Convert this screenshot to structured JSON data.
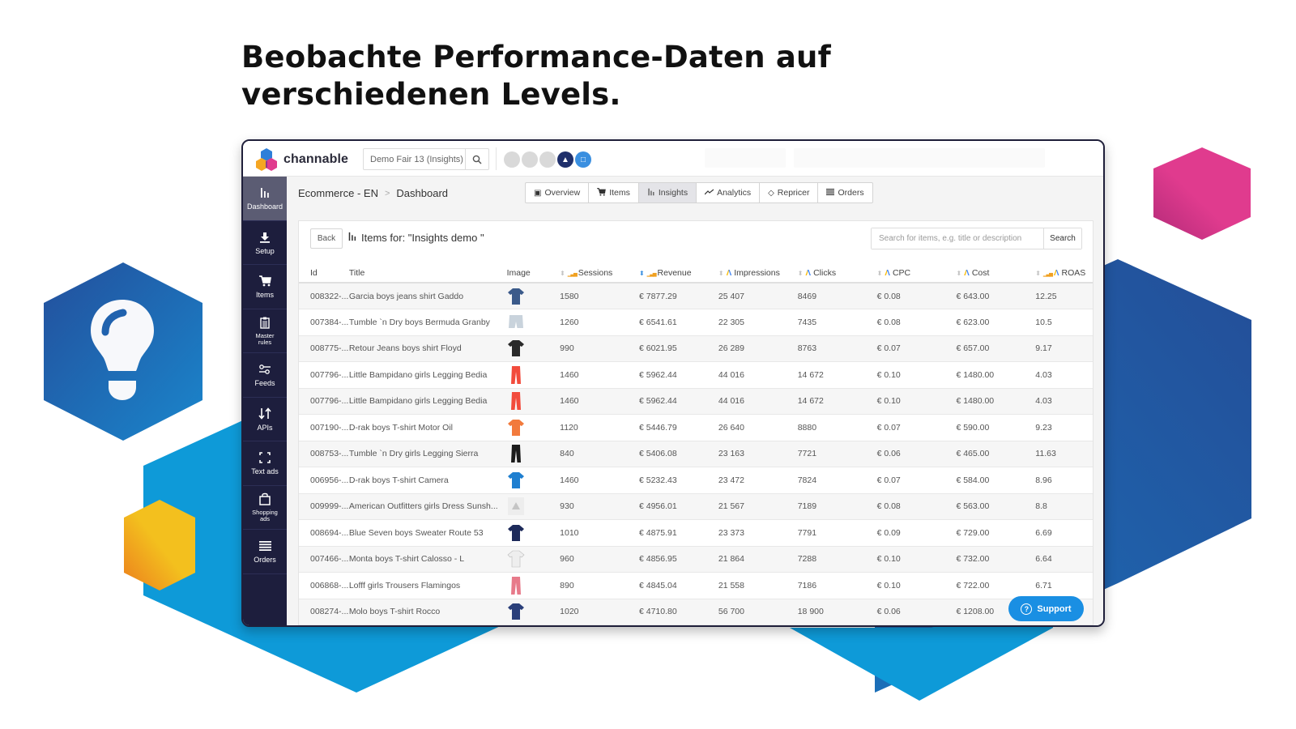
{
  "headline": {
    "line1": "Beobachte Performance-Daten auf",
    "line2": "verschiedenen Levels."
  },
  "app": {
    "brand": "channable",
    "project_select": "Demo Fair 13 (Insights)",
    "search_icon": "search-icon"
  },
  "sidebar": {
    "items": [
      {
        "label": "Dashboard",
        "icon": "bar-chart-icon",
        "glyph": "❙❙",
        "active": true
      },
      {
        "label": "Setup",
        "icon": "download-icon",
        "glyph": "⤓"
      },
      {
        "label": "Items",
        "icon": "cart-icon",
        "glyph": "🛒"
      },
      {
        "label": "Master rules",
        "icon": "clipboard-icon",
        "glyph": "☰"
      },
      {
        "label": "Feeds",
        "icon": "sliders-icon",
        "glyph": "⧟"
      },
      {
        "label": "APIs",
        "icon": "arrows-updown-icon",
        "glyph": "⇅"
      },
      {
        "label": "Text ads",
        "icon": "frame-icon",
        "glyph": "⛶"
      },
      {
        "label": "Shopping ads",
        "icon": "bag-icon",
        "glyph": "▢"
      },
      {
        "label": "Orders",
        "icon": "list-icon",
        "glyph": "≡"
      }
    ]
  },
  "breadcrumb": {
    "parent": "Ecommerce - EN",
    "separator": ">",
    "current": "Dashboard"
  },
  "nav_tabs": [
    {
      "label": "Overview",
      "icon": "monitor-icon",
      "glyph": "▣"
    },
    {
      "label": "Items",
      "icon": "cart-icon",
      "glyph": "⨼"
    },
    {
      "label": "Insights",
      "icon": "bar-chart-icon",
      "glyph": "┃┃",
      "active": true
    },
    {
      "label": "Analytics",
      "icon": "trend-line-icon",
      "glyph": "〜"
    },
    {
      "label": "Repricer",
      "icon": "tag-icon",
      "glyph": "◇"
    },
    {
      "label": "Orders",
      "icon": "list-icon",
      "glyph": "≡"
    }
  ],
  "panel": {
    "back_label": "Back",
    "title": "Items for: \"Insights demo \"",
    "search_placeholder": "Search for items, e.g. title or description",
    "search_value": "",
    "search_button": "Search"
  },
  "table": {
    "columns": [
      {
        "key": "id",
        "label": "Id"
      },
      {
        "key": "title",
        "label": "Title"
      },
      {
        "key": "image",
        "label": "Image"
      },
      {
        "key": "sessions",
        "label": "Sessions",
        "sortable": true,
        "source": "analytics"
      },
      {
        "key": "revenue",
        "label": "Revenue",
        "sortable": true,
        "sort_active": true,
        "source": "analytics"
      },
      {
        "key": "impressions",
        "label": "Impressions",
        "sortable": true,
        "source": "google-ads"
      },
      {
        "key": "clicks",
        "label": "Clicks",
        "sortable": true,
        "source": "google-ads"
      },
      {
        "key": "cpc",
        "label": "CPC",
        "sortable": true,
        "source": "google-ads"
      },
      {
        "key": "cost",
        "label": "Cost",
        "sortable": true,
        "source": "google-ads"
      },
      {
        "key": "roas",
        "label": "ROAS",
        "sortable": true,
        "source": "analytics+google-ads"
      }
    ],
    "rows": [
      {
        "id": "008322-...",
        "title": "Garcia boys jeans shirt Gaddo",
        "image": "denim-shirt",
        "image_color": "#3b5a8a",
        "sessions": "1580",
        "revenue": "€ 7877.29",
        "impressions": "25 407",
        "clicks": "8469",
        "cpc": "€ 0.08",
        "cost": "€ 643.00",
        "roas": "12.25"
      },
      {
        "id": "007384-...",
        "title": "Tumble `n Dry boys Bermuda Granby",
        "image": "shorts",
        "image_color": "#c9d3dc",
        "sessions": "1260",
        "revenue": "€ 6541.61",
        "impressions": "22 305",
        "clicks": "7435",
        "cpc": "€ 0.08",
        "cost": "€ 623.00",
        "roas": "10.5"
      },
      {
        "id": "008775-...",
        "title": "Retour Jeans boys shirt Floyd",
        "image": "jacket",
        "image_color": "#2a2a2a",
        "sessions": "990",
        "revenue": "€ 6021.95",
        "impressions": "26 289",
        "clicks": "8763",
        "cpc": "€ 0.07",
        "cost": "€ 657.00",
        "roas": "9.17"
      },
      {
        "id": "007796-...",
        "title": "Little Bampidano girls Legging Bedia",
        "image": "leggings",
        "image_color": "#f24b3c",
        "sessions": "1460",
        "revenue": "€ 5962.44",
        "impressions": "44 016",
        "clicks": "14 672",
        "cpc": "€ 0.10",
        "cost": "€ 1480.00",
        "roas": "4.03"
      },
      {
        "id": "007796-...",
        "title": "Little Bampidano girls Legging Bedia",
        "image": "leggings",
        "image_color": "#f24b3c",
        "sessions": "1460",
        "revenue": "€ 5962.44",
        "impressions": "44 016",
        "clicks": "14 672",
        "cpc": "€ 0.10",
        "cost": "€ 1480.00",
        "roas": "4.03"
      },
      {
        "id": "007190-...",
        "title": "D-rak boys T-shirt Motor Oil",
        "image": "tshirt",
        "image_color": "#f27a3c",
        "sessions": "1120",
        "revenue": "€ 5446.79",
        "impressions": "26 640",
        "clicks": "8880",
        "cpc": "€ 0.07",
        "cost": "€ 590.00",
        "roas": "9.23"
      },
      {
        "id": "008753-...",
        "title": "Tumble `n Dry girls Legging Sierra",
        "image": "leggings",
        "image_color": "#1c1c1c",
        "sessions": "840",
        "revenue": "€ 5406.08",
        "impressions": "23 163",
        "clicks": "7721",
        "cpc": "€ 0.06",
        "cost": "€ 465.00",
        "roas": "11.63"
      },
      {
        "id": "006956-...",
        "title": "D-rak boys T-shirt Camera",
        "image": "tshirt",
        "image_color": "#1f7fd0",
        "sessions": "1460",
        "revenue": "€ 5232.43",
        "impressions": "23 472",
        "clicks": "7824",
        "cpc": "€ 0.07",
        "cost": "€ 584.00",
        "roas": "8.96"
      },
      {
        "id": "009999-...",
        "title": "American Outfitters girls Dress Sunsh...",
        "image": "missing",
        "image_color": "#e2e2e2",
        "sessions": "930",
        "revenue": "€ 4956.01",
        "impressions": "21 567",
        "clicks": "7189",
        "cpc": "€ 0.08",
        "cost": "€ 563.00",
        "roas": "8.8"
      },
      {
        "id": "008694-...",
        "title": "Blue Seven boys Sweater Route 53",
        "image": "sweater",
        "image_color": "#1d2a5a",
        "sessions": "1010",
        "revenue": "€ 4875.91",
        "impressions": "23 373",
        "clicks": "7791",
        "cpc": "€ 0.09",
        "cost": "€ 729.00",
        "roas": "6.69"
      },
      {
        "id": "007466-...",
        "title": "Monta boys T-shirt Calosso - L",
        "image": "tshirt",
        "image_color": "#eeeeee",
        "sessions": "960",
        "revenue": "€ 4856.95",
        "impressions": "21 864",
        "clicks": "7288",
        "cpc": "€ 0.10",
        "cost": "€ 732.00",
        "roas": "6.64"
      },
      {
        "id": "006868-...",
        "title": "Lofff girls Trousers Flamingos",
        "image": "trousers",
        "image_color": "#e77a8a",
        "sessions": "890",
        "revenue": "€ 4845.04",
        "impressions": "21 558",
        "clicks": "7186",
        "cpc": "€ 0.10",
        "cost": "€ 722.00",
        "roas": "6.71"
      },
      {
        "id": "008274-...",
        "title": "Molo boys T-shirt Rocco",
        "image": "tshirt",
        "image_color": "#2a3f7a",
        "sessions": "1020",
        "revenue": "€ 4710.80",
        "impressions": "56 700",
        "clicks": "18 900",
        "cpc": "€ 0.06",
        "cost": "€ 1208.00",
        "roas": ""
      }
    ]
  },
  "support": {
    "label": "Support",
    "icon": "question-circle-icon"
  },
  "colors": {
    "sidebar_bg": "#1d1e3d",
    "sidebar_active": "#5b5c73",
    "accent_blue": "#1a8fe3",
    "deco_dark_blue": "#2356a0",
    "deco_light_blue": "#0e9ad8",
    "deco_pink": "#e03b8e",
    "deco_yellow": "#f3c01e"
  }
}
